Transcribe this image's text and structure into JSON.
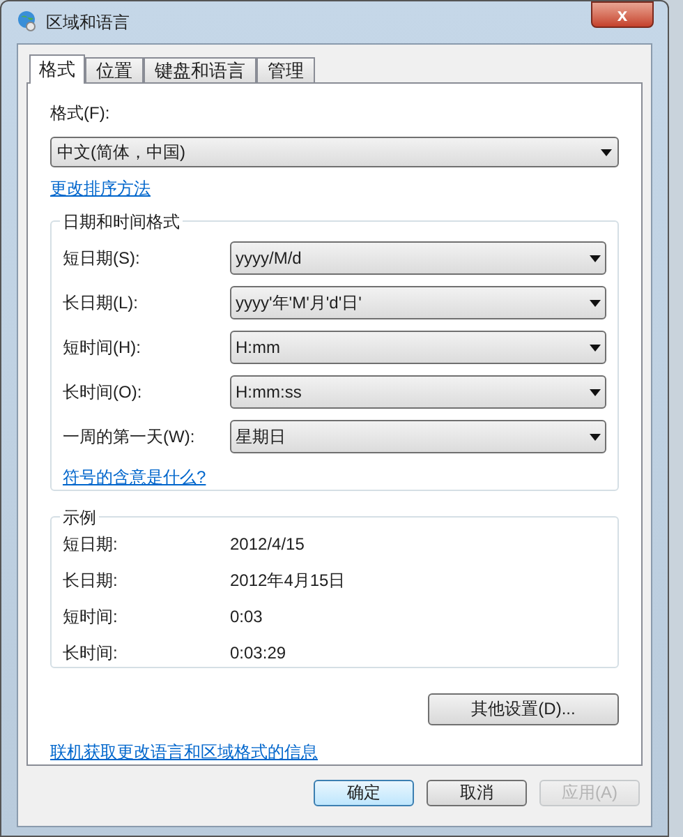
{
  "window": {
    "title": "区域和语言",
    "close": "x"
  },
  "tabs": [
    {
      "label": "格式",
      "selected": true
    },
    {
      "label": "位置",
      "selected": false
    },
    {
      "label": "键盘和语言",
      "selected": false
    },
    {
      "label": "管理",
      "selected": false
    }
  ],
  "format": {
    "label": "格式(F):",
    "value": "中文(简体，中国)",
    "link": "更改排序方法"
  },
  "date_time_formats": {
    "title": "日期和时间格式",
    "rows": [
      {
        "label": "短日期(S):",
        "value": "yyyy/M/d"
      },
      {
        "label": "长日期(L):",
        "value": "yyyy'年'M'月'd'日'"
      },
      {
        "label": "短时间(H):",
        "value": "H:mm"
      },
      {
        "label": "长时间(O):",
        "value": "H:mm:ss"
      },
      {
        "label": "一周的第一天(W):",
        "value": "星期日"
      }
    ],
    "link": "符号的含意是什么?"
  },
  "examples": {
    "title": "示例",
    "rows": [
      {
        "label": "短日期:",
        "value": "2012/4/15"
      },
      {
        "label": "长日期:",
        "value": "2012年4月15日"
      },
      {
        "label": "短时间:",
        "value": "0:03"
      },
      {
        "label": "长时间:",
        "value": "0:03:29"
      }
    ]
  },
  "more_button": "其他设置(D)...",
  "online_link": "联机获取更改语言和区域格式的信息",
  "buttons": [
    {
      "label": "确定",
      "default": true,
      "disabled": false
    },
    {
      "label": "取消",
      "default": false,
      "disabled": false
    },
    {
      "label": "应用(A)",
      "default": false,
      "disabled": true
    }
  ]
}
